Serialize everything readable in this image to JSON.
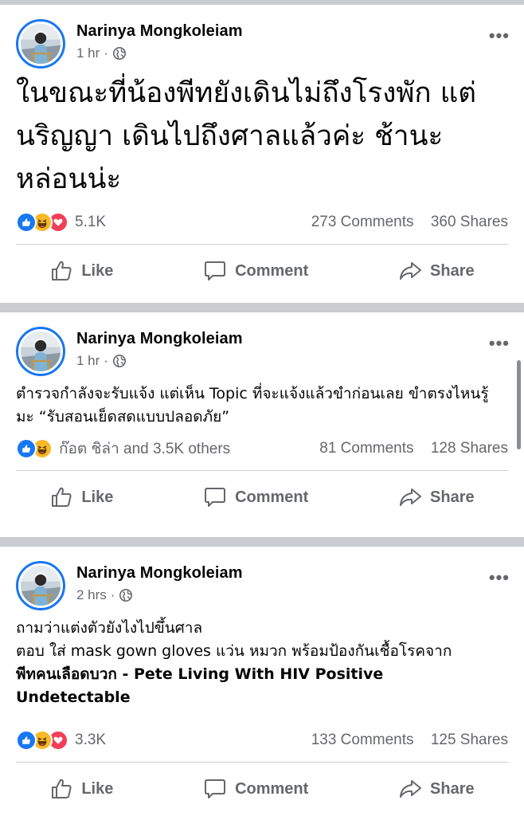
{
  "posts": [
    {
      "author": "Narinya Mongkoleiam",
      "time": "1 hr",
      "text": "ในขณะที่น้องพีทยังเดินไม่ถึงโรงพัก แต่นริญญา เดินไปถึงศาลแล้วค่ะ ช้านะหล่อนน่ะ",
      "reactions": [
        "like",
        "haha",
        "love"
      ],
      "reaction_count": "5.1K",
      "comments": "273 Comments",
      "shares": "360 Shares"
    },
    {
      "author": "Narinya Mongkoleiam",
      "time": "1 hr",
      "text": "ตำรวจกำลังจะรับแจ้ง แต่เห็น Topic ที่จะแจ้งแล้วขำก่อนเลย ขำตรงไหนรู้มะ “รับสอนเย็ดสดแบบปลอดภัย”",
      "reactions": [
        "like",
        "haha"
      ],
      "reaction_count": "ก๊อต ชิล่า and 3.5K others",
      "comments": "81 Comments",
      "shares": "128 Shares"
    },
    {
      "author": "Narinya Mongkoleiam",
      "time": "2 hrs",
      "text_line1": "ถามว่าแต่งตัวยังไงไปขึ้นศาล",
      "text_line2": "ตอบ ใส่ mask gown gloves แว่น หมวก พร้อมป้องกันเชื้อโรคจาก",
      "text_bold": "พีทคนเลือดบวก - Pete Living With HIV Positive Undetectable",
      "reactions": [
        "like",
        "haha",
        "love"
      ],
      "reaction_count": "3.3K",
      "comments": "133 Comments",
      "shares": "125 Shares"
    }
  ],
  "actions": {
    "like": "Like",
    "comment": "Comment",
    "share": "Share"
  },
  "icons": {
    "more": "more-dots-icon",
    "audience": "globe-icon",
    "like": "thumbs-up-icon",
    "comment": "comment-bubble-icon",
    "share": "share-arrow-icon"
  },
  "colors": {
    "accent": "#1877f2",
    "secondary_text": "#65676b",
    "separator": "#c9ccd1"
  }
}
